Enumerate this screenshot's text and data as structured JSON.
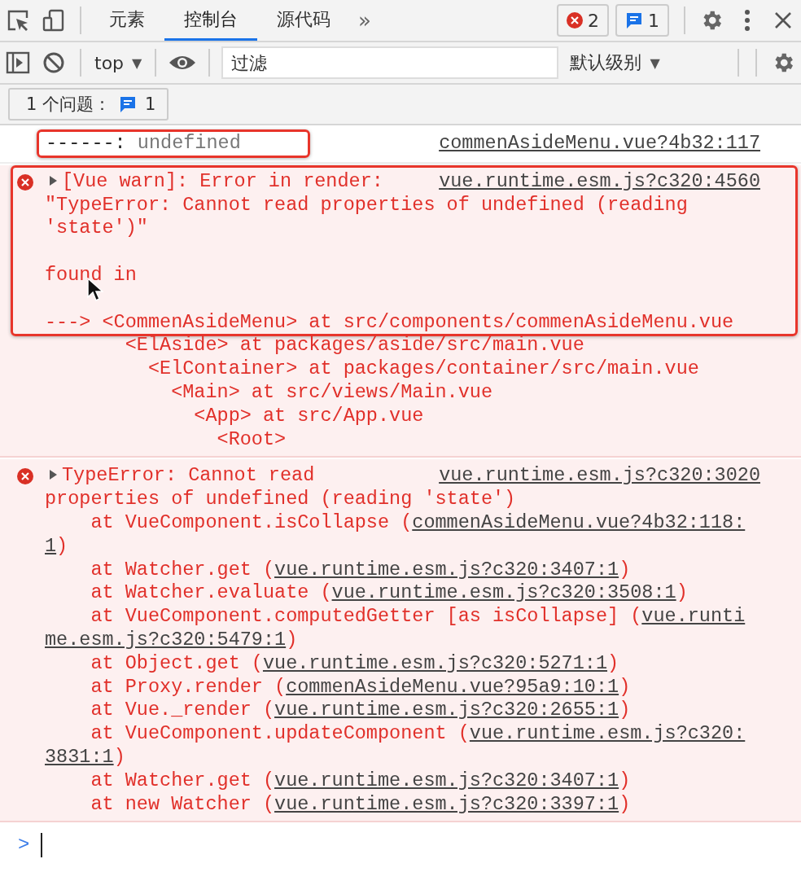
{
  "tabs": [
    {
      "label": "元素",
      "selected": false
    },
    {
      "label": "控制台",
      "selected": true
    },
    {
      "label": "源代码",
      "selected": false
    }
  ],
  "more_tabs": "»",
  "error_count": "2",
  "message_count": "1",
  "toolbar": {
    "context": "top",
    "context_caret": "▼",
    "filter": {
      "placeholder": "过滤"
    },
    "levels": "默认级别",
    "levels_caret": "▼"
  },
  "issues": {
    "label": "1 个问题：",
    "count": "1"
  },
  "entries": [
    {
      "kind": "log",
      "source": "commenAsideMenu.vue?4b32:117",
      "highlighted_lines": [
        {
          "segments": [
            {
              "kind": "plain",
              "text": "------:"
            },
            {
              "kind": "dim",
              "text": " undefined"
            }
          ]
        }
      ]
    },
    {
      "kind": "error",
      "expandable": true,
      "source": "vue.runtime.esm.js?c320:4560",
      "highlighted_lines": [
        {
          "segments": [
            {
              "kind": "plain",
              "text": "[Vue warn]: Error in render:"
            }
          ]
        },
        {
          "segments": [
            {
              "kind": "plain",
              "text": "\"TypeError: Cannot read properties of undefined (reading"
            }
          ]
        },
        {
          "segments": [
            {
              "kind": "plain",
              "text": "'state')\""
            }
          ]
        },
        {
          "kind": "blank"
        },
        {
          "pointer": true,
          "segments": [
            {
              "kind": "plain",
              "text": "found in"
            }
          ]
        },
        {
          "kind": "blank"
        },
        {
          "segments": [
            {
              "kind": "plain",
              "text": "---> <CommenAsideMenu> at src/components/commenAsideMenu.vue"
            }
          ]
        }
      ],
      "lines": [
        {
          "segments": [
            {
              "kind": "plain",
              "text": "       <ElAside> at packages/aside/src/main.vue"
            }
          ]
        },
        {
          "segments": [
            {
              "kind": "plain",
              "text": "         <ElContainer> at packages/container/src/main.vue"
            }
          ]
        },
        {
          "segments": [
            {
              "kind": "plain",
              "text": "           <Main> at src/views/Main.vue"
            }
          ]
        },
        {
          "segments": [
            {
              "kind": "plain",
              "text": "             <App> at src/App.vue"
            }
          ]
        },
        {
          "segments": [
            {
              "kind": "plain",
              "text": "               <Root>"
            }
          ]
        }
      ]
    },
    {
      "kind": "error",
      "expandable": true,
      "source": "vue.runtime.esm.js?c320:3020",
      "lines": [
        {
          "segments": [
            {
              "kind": "plain",
              "text": "TypeError: Cannot read"
            }
          ]
        },
        {
          "segments": [
            {
              "kind": "plain",
              "text": "properties of undefined (reading 'state')"
            }
          ]
        },
        {
          "segments": [
            {
              "kind": "plain",
              "text": "    at VueComponent.isCollapse ("
            },
            {
              "kind": "link",
              "text": "commenAsideMenu.vue?4b32:118:"
            }
          ]
        },
        {
          "segments": [
            {
              "kind": "link",
              "text": "1"
            },
            {
              "kind": "plain",
              "text": ")"
            }
          ]
        },
        {
          "segments": [
            {
              "kind": "plain",
              "text": "    at Watcher.get ("
            },
            {
              "kind": "link",
              "text": "vue.runtime.esm.js?c320:3407:1"
            },
            {
              "kind": "plain",
              "text": ")"
            }
          ]
        },
        {
          "segments": [
            {
              "kind": "plain",
              "text": "    at Watcher.evaluate ("
            },
            {
              "kind": "link",
              "text": "vue.runtime.esm.js?c320:3508:1"
            },
            {
              "kind": "plain",
              "text": ")"
            }
          ]
        },
        {
          "segments": [
            {
              "kind": "plain",
              "text": "    at VueComponent.computedGetter [as isCollapse] ("
            },
            {
              "kind": "link",
              "text": "vue.runti"
            }
          ]
        },
        {
          "segments": [
            {
              "kind": "link",
              "text": "me.esm.js?c320:5479:1"
            },
            {
              "kind": "plain",
              "text": ")"
            }
          ]
        },
        {
          "segments": [
            {
              "kind": "plain",
              "text": "    at Object.get ("
            },
            {
              "kind": "link",
              "text": "vue.runtime.esm.js?c320:5271:1"
            },
            {
              "kind": "plain",
              "text": ")"
            }
          ]
        },
        {
          "segments": [
            {
              "kind": "plain",
              "text": "    at Proxy.render ("
            },
            {
              "kind": "link",
              "text": "commenAsideMenu.vue?95a9:10:1"
            },
            {
              "kind": "plain",
              "text": ")"
            }
          ]
        },
        {
          "segments": [
            {
              "kind": "plain",
              "text": "    at Vue._render ("
            },
            {
              "kind": "link",
              "text": "vue.runtime.esm.js?c320:2655:1"
            },
            {
              "kind": "plain",
              "text": ")"
            }
          ]
        },
        {
          "segments": [
            {
              "kind": "plain",
              "text": "    at VueComponent.updateComponent ("
            },
            {
              "kind": "link",
              "text": "vue.runtime.esm.js?c320:"
            }
          ]
        },
        {
          "segments": [
            {
              "kind": "link",
              "text": "3831:1"
            },
            {
              "kind": "plain",
              "text": ")"
            }
          ]
        },
        {
          "segments": [
            {
              "kind": "plain",
              "text": "    at Watcher.get ("
            },
            {
              "kind": "link",
              "text": "vue.runtime.esm.js?c320:3407:1"
            },
            {
              "kind": "plain",
              "text": ")"
            }
          ]
        },
        {
          "segments": [
            {
              "kind": "plain",
              "text": "    at new Watcher ("
            },
            {
              "kind": "link",
              "text": "vue.runtime.esm.js?c320:3397:1"
            },
            {
              "kind": "plain",
              "text": ")"
            }
          ]
        }
      ]
    }
  ],
  "prompt": ">"
}
